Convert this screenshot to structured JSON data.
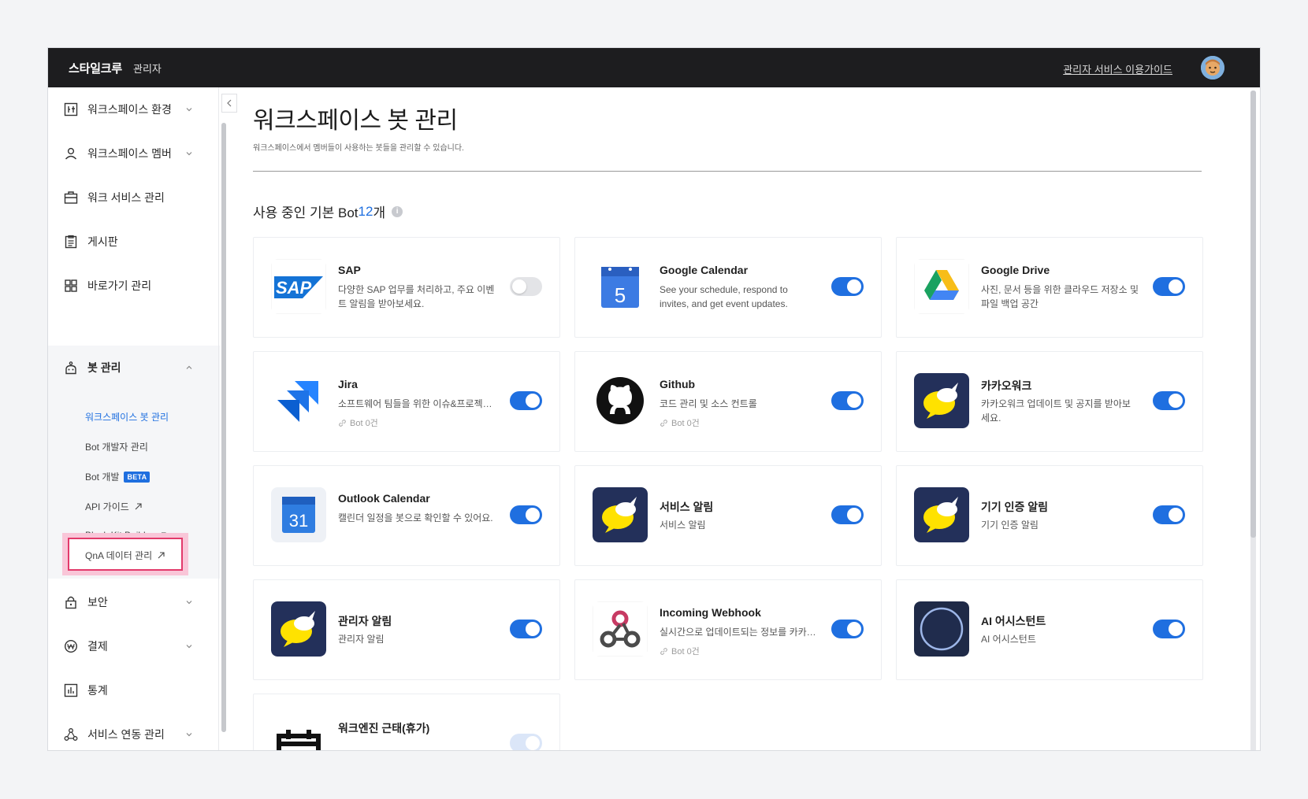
{
  "topbar": {
    "brand": "스타일크루",
    "brand_sub": "관리자",
    "guide_link": "관리자 서비스 이용가이드"
  },
  "sidebar": {
    "items": [
      {
        "label": "워크스페이스 환경",
        "icon": "settings-sliders-icon"
      },
      {
        "label": "워크스페이스 멤버",
        "icon": "person-icon"
      },
      {
        "label": "워크 서비스 관리",
        "icon": "briefcase-icon"
      },
      {
        "label": "게시판",
        "icon": "clipboard-icon"
      },
      {
        "label": "바로가기 관리",
        "icon": "grid-icon"
      },
      {
        "label": "봇 관리",
        "icon": "robot-icon"
      },
      {
        "label": "보안",
        "icon": "lock-icon"
      },
      {
        "label": "결제",
        "icon": "won-icon"
      },
      {
        "label": "통계",
        "icon": "chart-icon"
      },
      {
        "label": "서비스 연동 관리",
        "icon": "share-icon"
      }
    ],
    "bot_sub": [
      {
        "label": "워크스페이스 봇 관리"
      },
      {
        "label": "Bot 개발자 관리"
      },
      {
        "label": "Bot 개발",
        "badge": "BETA"
      },
      {
        "label": "API 가이드"
      },
      {
        "label": "Block Kit Builder"
      },
      {
        "label": "QnA 데이터 관리"
      }
    ]
  },
  "main": {
    "title": "워크스페이스 봇 관리",
    "description": "워크스페이스에서 멤버들이 사용하는 봇들을 관리할 수 있습니다.",
    "section_title_prefix": "사용 중인 기본 Bot ",
    "section_count": "12",
    "section_suffix": "개",
    "info_glyph": "i"
  },
  "bots": [
    {
      "name": "SAP",
      "description": "다양한 SAP 업무를 처리하고, 주요 이벤트 알림을 받아보세요.",
      "enabled": false
    },
    {
      "name": "Google Calendar",
      "description": "See your schedule, respond to invites, and get event updates.",
      "enabled": true
    },
    {
      "name": "Google Drive",
      "description": "사진, 문서 등을 위한 클라우드 저장소 및 파일 백업 공간",
      "enabled": true
    },
    {
      "name": "Jira",
      "description": "소프트웨어 팀들을 위한 이슈&프로젝트 관리",
      "meta": "Bot 0건",
      "enabled": true
    },
    {
      "name": "Github",
      "description": "코드 관리 및 소스 컨트롤",
      "meta": "Bot 0건",
      "enabled": true
    },
    {
      "name": "카카오워크",
      "description": "카카오워크 업데이트 및 공지를 받아보세요.",
      "enabled": true
    },
    {
      "name": "Outlook Calendar",
      "description": "캘린더 일정을 봇으로 확인할 수 있어요.",
      "enabled": true,
      "calendar_day": "31"
    },
    {
      "name": "서비스 알림",
      "description": "서비스 알림",
      "enabled": true
    },
    {
      "name": "기기 인증 알림",
      "description": "기기 인증 알림",
      "enabled": true
    },
    {
      "name": "관리자 알림",
      "description": "관리자 알림",
      "enabled": true
    },
    {
      "name": "Incoming Webhook",
      "description": "실시간으로 업데이트되는 정보를 카카오워크로 받아보세요",
      "meta": "Bot 0건",
      "enabled": true
    },
    {
      "name": "AI 어시스턴트",
      "description": "AI 어시스턴트",
      "enabled": true
    },
    {
      "name": "워크엔진 근태(휴가)",
      "description": "",
      "enabled": true
    }
  ],
  "google_calendar_day": "5",
  "colors": {
    "accent": "#1f6fe0",
    "topbar": "#1d1d1f",
    "highlight": "#e23a6b"
  }
}
